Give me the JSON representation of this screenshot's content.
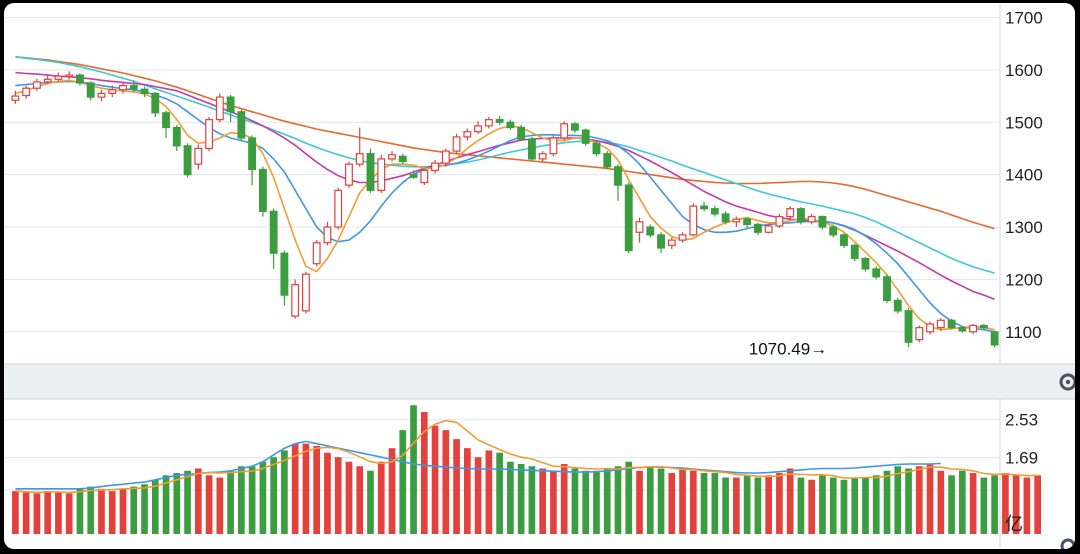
{
  "chart_data": [
    {
      "type": "candlestick",
      "ylim": [
        1050,
        1720
      ],
      "yticks": [
        1100,
        1200,
        1300,
        1400,
        1500,
        1600,
        1700
      ],
      "grid": true,
      "annotation": {
        "label": "1070.49→",
        "value": 1070.49,
        "index": 76
      },
      "colors": {
        "up": "#e3413b",
        "down": "#3b9d3f",
        "ma5": "#f39c33",
        "ma10": "#3f97e8",
        "ma20": "#c53aa6",
        "ma30": "#3bc8d8",
        "ma60": "#e8692a"
      },
      "candles": [
        [
          1542,
          1550,
          1560,
          1535
        ],
        [
          1551,
          1565,
          1570,
          1545
        ],
        [
          1565,
          1577,
          1583,
          1560
        ],
        [
          1577,
          1582,
          1590,
          1572
        ],
        [
          1582,
          1588,
          1595,
          1578
        ],
        [
          1588,
          1590,
          1597,
          1582
        ],
        [
          1590,
          1575,
          1593,
          1570
        ],
        [
          1575,
          1548,
          1578,
          1542
        ],
        [
          1548,
          1555,
          1562,
          1540
        ],
        [
          1555,
          1562,
          1570,
          1548
        ],
        [
          1562,
          1570,
          1577,
          1555
        ],
        [
          1570,
          1563,
          1580,
          1558
        ],
        [
          1563,
          1555,
          1568,
          1548
        ],
        [
          1555,
          1518,
          1558,
          1510
        ],
        [
          1518,
          1490,
          1522,
          1470
        ],
        [
          1490,
          1455,
          1495,
          1445
        ],
        [
          1455,
          1400,
          1460,
          1395
        ],
        [
          1420,
          1450,
          1458,
          1410
        ],
        [
          1450,
          1505,
          1510,
          1445
        ],
        [
          1505,
          1548,
          1555,
          1500
        ],
        [
          1548,
          1520,
          1552,
          1500
        ],
        [
          1520,
          1470,
          1524,
          1465
        ],
        [
          1470,
          1410,
          1475,
          1380
        ],
        [
          1410,
          1330,
          1415,
          1320
        ],
        [
          1330,
          1250,
          1335,
          1220
        ],
        [
          1250,
          1170,
          1255,
          1150
        ],
        [
          1130,
          1190,
          1200,
          1125
        ],
        [
          1140,
          1210,
          1215,
          1135
        ],
        [
          1230,
          1270,
          1275,
          1225
        ],
        [
          1270,
          1300,
          1310,
          1265
        ],
        [
          1300,
          1370,
          1375,
          1295
        ],
        [
          1380,
          1420,
          1425,
          1375
        ],
        [
          1420,
          1440,
          1490,
          1415
        ],
        [
          1440,
          1370,
          1450,
          1365
        ],
        [
          1370,
          1430,
          1438,
          1365
        ],
        [
          1430,
          1438,
          1445,
          1425
        ],
        [
          1435,
          1425,
          1440,
          1420
        ],
        [
          1400,
          1395,
          1408,
          1392
        ],
        [
          1385,
          1408,
          1412,
          1380
        ],
        [
          1408,
          1422,
          1428,
          1402
        ],
        [
          1422,
          1445,
          1450,
          1415
        ],
        [
          1445,
          1472,
          1478,
          1440
        ],
        [
          1472,
          1482,
          1488,
          1465
        ],
        [
          1482,
          1493,
          1502,
          1478
        ],
        [
          1493,
          1505,
          1510,
          1488
        ],
        [
          1505,
          1500,
          1512,
          1495
        ],
        [
          1500,
          1490,
          1505,
          1485
        ],
        [
          1490,
          1468,
          1495,
          1465
        ],
        [
          1468,
          1430,
          1472,
          1425
        ],
        [
          1430,
          1440,
          1445,
          1425
        ],
        [
          1440,
          1470,
          1475,
          1435
        ],
        [
          1470,
          1497,
          1502,
          1465
        ],
        [
          1497,
          1485,
          1500,
          1480
        ],
        [
          1485,
          1460,
          1488,
          1455
        ],
        [
          1460,
          1440,
          1465,
          1435
        ],
        [
          1440,
          1415,
          1445,
          1410
        ],
        [
          1415,
          1380,
          1420,
          1350
        ],
        [
          1380,
          1255,
          1385,
          1250
        ],
        [
          1290,
          1310,
          1318,
          1270
        ],
        [
          1300,
          1285,
          1305,
          1280
        ],
        [
          1285,
          1260,
          1290,
          1250
        ],
        [
          1265,
          1275,
          1280,
          1258
        ],
        [
          1275,
          1285,
          1290,
          1270
        ],
        [
          1285,
          1340,
          1345,
          1282
        ],
        [
          1340,
          1335,
          1348,
          1330
        ],
        [
          1335,
          1325,
          1340,
          1320
        ],
        [
          1325,
          1310,
          1330,
          1305
        ],
        [
          1310,
          1315,
          1320,
          1300
        ],
        [
          1315,
          1305,
          1318,
          1298
        ],
        [
          1305,
          1290,
          1308,
          1285
        ],
        [
          1290,
          1302,
          1306,
          1288
        ],
        [
          1302,
          1320,
          1325,
          1298
        ],
        [
          1320,
          1335,
          1340,
          1315
        ],
        [
          1335,
          1310,
          1338,
          1305
        ],
        [
          1310,
          1320,
          1325,
          1305
        ],
        [
          1320,
          1300,
          1322,
          1295
        ],
        [
          1300,
          1285,
          1305,
          1280
        ],
        [
          1285,
          1265,
          1288,
          1260
        ],
        [
          1265,
          1240,
          1268,
          1235
        ],
        [
          1240,
          1220,
          1243,
          1215
        ],
        [
          1220,
          1205,
          1225,
          1200
        ],
        [
          1205,
          1160,
          1210,
          1155
        ],
        [
          1160,
          1140,
          1165,
          1135
        ],
        [
          1140,
          1080,
          1145,
          1070.49
        ],
        [
          1085,
          1108,
          1112,
          1080
        ],
        [
          1100,
          1115,
          1120,
          1095
        ],
        [
          1108,
          1122,
          1126,
          1102
        ],
        [
          1122,
          1108,
          1125,
          1105
        ],
        [
          1108,
          1102,
          1112,
          1098
        ],
        [
          1100,
          1112,
          1115,
          1096
        ],
        [
          1112,
          1108,
          1115,
          1104
        ],
        [
          1100,
          1075,
          1102,
          1070
        ]
      ],
      "ma5": [
        1555,
        1560,
        1568,
        1574,
        1578,
        1580,
        1576,
        1570,
        1565,
        1562,
        1560,
        1558,
        1554,
        1545,
        1530,
        1505,
        1475,
        1460,
        1462,
        1470,
        1480,
        1478,
        1470,
        1440,
        1395,
        1335,
        1275,
        1225,
        1215,
        1240,
        1275,
        1320,
        1365,
        1390,
        1410,
        1420,
        1420,
        1418,
        1412,
        1412,
        1420,
        1432,
        1450,
        1465,
        1478,
        1488,
        1493,
        1490,
        1480,
        1470,
        1465,
        1465,
        1470,
        1470,
        1460,
        1450,
        1428,
        1390,
        1355,
        1320,
        1298,
        1282,
        1275,
        1278,
        1290,
        1300,
        1308,
        1314,
        1318,
        1312,
        1308,
        1308,
        1312,
        1316,
        1315,
        1310,
        1302,
        1290,
        1272,
        1252,
        1232,
        1208,
        1180,
        1150,
        1125,
        1110,
        1104,
        1106,
        1108,
        1110,
        1108,
        1104
      ],
      "ma10": [
        1570,
        1572,
        1574,
        1576,
        1577,
        1578,
        1577,
        1574,
        1570,
        1567,
        1564,
        1562,
        1558,
        1552,
        1545,
        1535,
        1520,
        1505,
        1490,
        1478,
        1470,
        1465,
        1460,
        1450,
        1430,
        1405,
        1370,
        1335,
        1300,
        1280,
        1272,
        1275,
        1290,
        1312,
        1340,
        1365,
        1385,
        1400,
        1410,
        1415,
        1418,
        1422,
        1428,
        1436,
        1445,
        1455,
        1465,
        1472,
        1475,
        1476,
        1476,
        1475,
        1475,
        1474,
        1470,
        1465,
        1455,
        1440,
        1420,
        1395,
        1370,
        1345,
        1320,
        1305,
        1295,
        1290,
        1290,
        1292,
        1297,
        1302,
        1305,
        1307,
        1308,
        1310,
        1311,
        1310,
        1308,
        1303,
        1295,
        1283,
        1268,
        1250,
        1230,
        1205,
        1180,
        1155,
        1135,
        1120,
        1110,
        1106,
        1104,
        1100
      ],
      "ma20": [
        1595,
        1593,
        1592,
        1590,
        1588,
        1587,
        1585,
        1583,
        1580,
        1578,
        1576,
        1574,
        1572,
        1568,
        1564,
        1560,
        1552,
        1544,
        1536,
        1528,
        1520,
        1512,
        1503,
        1493,
        1482,
        1470,
        1456,
        1440,
        1424,
        1410,
        1398,
        1390,
        1385,
        1385,
        1388,
        1393,
        1398,
        1405,
        1412,
        1418,
        1425,
        1432,
        1438,
        1444,
        1450,
        1456,
        1461,
        1466,
        1468,
        1469,
        1470,
        1470,
        1470,
        1468,
        1465,
        1460,
        1454,
        1446,
        1436,
        1426,
        1415,
        1404,
        1392,
        1380,
        1368,
        1358,
        1348,
        1340,
        1334,
        1328,
        1322,
        1318,
        1315,
        1313,
        1312,
        1311,
        1308,
        1302,
        1294,
        1284,
        1274,
        1264,
        1254,
        1243,
        1232,
        1220,
        1208,
        1197,
        1187,
        1177,
        1170,
        1162
      ],
      "ma30": [
        1625,
        1622,
        1620,
        1617,
        1614,
        1610,
        1606,
        1601,
        1596,
        1590,
        1584,
        1578,
        1571,
        1564,
        1557,
        1550,
        1543,
        1536,
        1529,
        1521,
        1514,
        1507,
        1500,
        1493,
        1485,
        1477,
        1469,
        1460,
        1452,
        1445,
        1438,
        1432,
        1427,
        1423,
        1420,
        1418,
        1416,
        1415,
        1415,
        1416,
        1418,
        1421,
        1424,
        1428,
        1433,
        1438,
        1443,
        1447,
        1451,
        1455,
        1458,
        1461,
        1463,
        1464,
        1464,
        1462,
        1458,
        1453,
        1446,
        1440,
        1433,
        1426,
        1418,
        1411,
        1404,
        1397,
        1390,
        1383,
        1376,
        1369,
        1363,
        1358,
        1353,
        1348,
        1344,
        1340,
        1335,
        1330,
        1325,
        1318,
        1310,
        1300,
        1290,
        1280,
        1270,
        1260,
        1250,
        1240,
        1232,
        1224,
        1218,
        1212
      ],
      "ma60": [
        1625,
        1623,
        1621,
        1619,
        1616,
        1613,
        1610,
        1606,
        1602,
        1598,
        1594,
        1589,
        1584,
        1579,
        1573,
        1567,
        1560,
        1553,
        1546,
        1539,
        1532,
        1526,
        1520,
        1514,
        1508,
        1502,
        1497,
        1492,
        1487,
        1483,
        1479,
        1475,
        1471,
        1467,
        1463,
        1459,
        1455,
        1451,
        1448,
        1445,
        1442,
        1440,
        1438,
        1436,
        1434,
        1432,
        1430,
        1428,
        1426,
        1424,
        1422,
        1420,
        1418,
        1416,
        1414,
        1412,
        1409,
        1406,
        1403,
        1400,
        1397,
        1394,
        1391,
        1389,
        1387,
        1385,
        1384,
        1383,
        1383,
        1383,
        1384,
        1385,
        1386,
        1387,
        1387,
        1386,
        1384,
        1381,
        1377,
        1372,
        1366,
        1360,
        1354,
        1348,
        1342,
        1336,
        1330,
        1323,
        1316,
        1309,
        1303,
        1297
      ]
    },
    {
      "type": "bar",
      "unit": "亿",
      "yticks": [
        1.69,
        2.53
      ],
      "ylim": [
        0,
        2.9
      ],
      "volume": [
        0.95,
        0.92,
        0.9,
        0.95,
        0.93,
        0.9,
        1.0,
        1.05,
        1.0,
        0.95,
        1.0,
        1.05,
        1.1,
        1.2,
        1.3,
        1.35,
        1.4,
        1.45,
        1.3,
        1.25,
        1.4,
        1.5,
        1.5,
        1.6,
        1.7,
        1.85,
        2.0,
        2.0,
        1.95,
        1.8,
        1.7,
        1.6,
        1.5,
        1.4,
        1.6,
        1.9,
        2.3,
        2.85,
        2.7,
        2.4,
        2.3,
        2.1,
        1.9,
        1.7,
        1.85,
        1.8,
        1.6,
        1.55,
        1.5,
        1.45,
        1.4,
        1.55,
        1.45,
        1.4,
        1.4,
        1.45,
        1.5,
        1.6,
        1.4,
        1.5,
        1.45,
        1.35,
        1.45,
        1.4,
        1.35,
        1.35,
        1.25,
        1.25,
        1.3,
        1.25,
        1.3,
        1.35,
        1.45,
        1.25,
        1.2,
        1.3,
        1.25,
        1.2,
        1.25,
        1.25,
        1.3,
        1.4,
        1.5,
        1.45,
        1.5,
        1.55,
        1.4,
        1.3,
        1.4,
        1.35,
        1.25,
        1.3,
        1.35,
        1.3,
        1.25,
        1.3
      ],
      "volume_ma": [
        1.0,
        1.0,
        1.0,
        1.0,
        1.0,
        1.0,
        1.0,
        1.02,
        1.05,
        1.08,
        1.1,
        1.13,
        1.15,
        1.2,
        1.25,
        1.3,
        1.32,
        1.34,
        1.36,
        1.37,
        1.4,
        1.45,
        1.5,
        1.6,
        1.75,
        1.9,
        2.0,
        2.05,
        2.0,
        1.95,
        1.9,
        1.85,
        1.8,
        1.75,
        1.7,
        1.65,
        1.6,
        1.55,
        1.52,
        1.5,
        1.48,
        1.46,
        1.45,
        1.44,
        1.44,
        1.44,
        1.43,
        1.42,
        1.41,
        1.4,
        1.39,
        1.38,
        1.37,
        1.37,
        1.38,
        1.4,
        1.42,
        1.45,
        1.47,
        1.48,
        1.48,
        1.47,
        1.46,
        1.44,
        1.42,
        1.4,
        1.38,
        1.36,
        1.35,
        1.35,
        1.36,
        1.38,
        1.4,
        1.42,
        1.44,
        1.45,
        1.45,
        1.45,
        1.46,
        1.48,
        1.5,
        1.52,
        1.54,
        1.55,
        1.55,
        1.55,
        1.56
      ]
    }
  ]
}
